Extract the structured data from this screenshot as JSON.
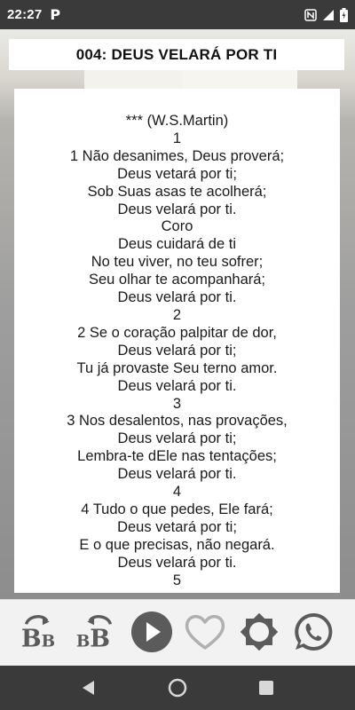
{
  "status_bar": {
    "time": "22:27",
    "app_badge": "P"
  },
  "title": "004: DEUS VELARÁ POR TI",
  "lyrics": [
    "*** (W.S.Martin)",
    "1",
    "1 Não desanimes, Deus proverá;",
    "Deus vetará por ti;",
    "Sob Suas asas te acolherá;",
    "Deus velará por ti.",
    "Coro",
    "Deus cuidará de ti",
    "No teu viver, no teu sofrer;",
    "Seu olhar te acompanhará;",
    "Deus velará por ti.",
    "2",
    "2 Se o coração palpitar de dor,",
    "Deus velará por ti;",
    "Tu já provaste Seu terno amor.",
    "Deus velará por ti.",
    "3",
    "3 Nos desalentos, nas provações,",
    "Deus velará por ti;",
    "Lembra-te dEle nas tentações;",
    "Deus velará por ti.",
    "4",
    "4 Tudo o que pedes, Ele fará;",
    "Deus vetará por ti;",
    "E o que precisas, não negará.",
    "Deus velará por ti.",
    "5"
  ],
  "toolbar": {
    "font_increase_letters": "BB",
    "font_decrease_letters": "BB",
    "tools": [
      {
        "icon": "font-size-increase-icon"
      },
      {
        "icon": "font-size-decrease-icon"
      },
      {
        "icon": "play-icon"
      },
      {
        "icon": "heart-icon"
      },
      {
        "icon": "brightness-icon"
      },
      {
        "icon": "whatsapp-icon"
      }
    ]
  },
  "colors": {
    "status_bar": "#3a3a3a",
    "icon_gray": "#5b5b5b",
    "heart_gray": "#b0b0b0"
  }
}
